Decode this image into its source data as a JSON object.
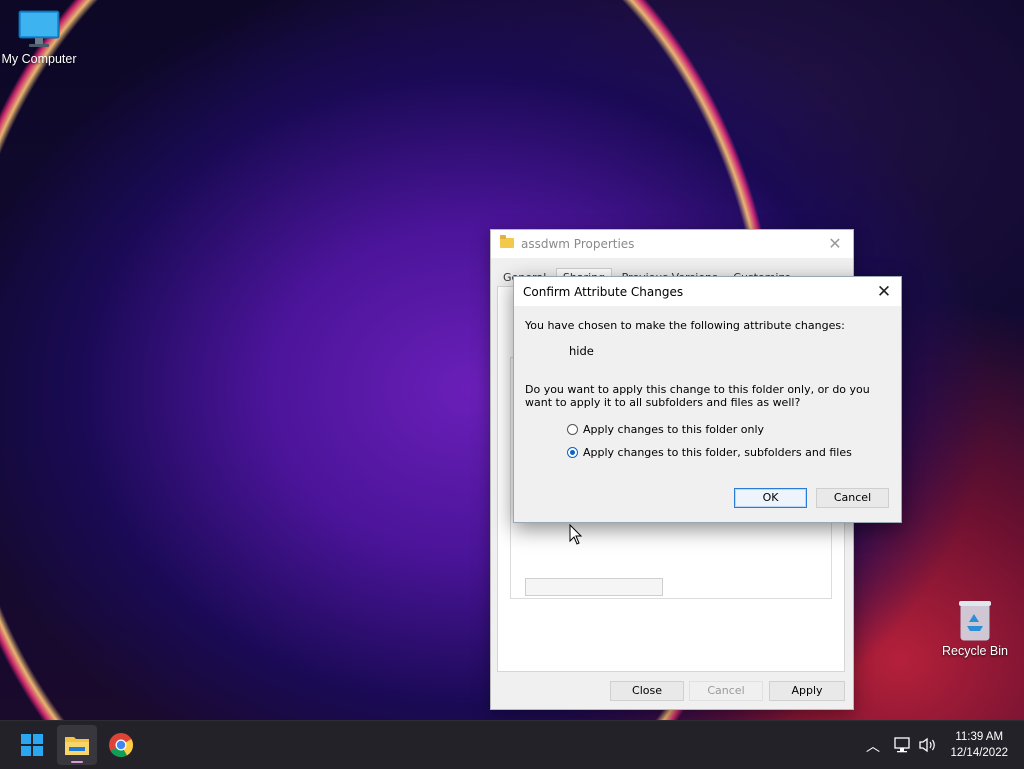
{
  "desktop": {
    "icons": [
      {
        "label": "My Computer",
        "icon": "monitor-icon"
      },
      {
        "label": "Recycle Bin",
        "icon": "recycle-bin-icon"
      }
    ]
  },
  "properties_window": {
    "title": "assdwm Properties",
    "tabs": [
      "General",
      "Sharing",
      "Previous Versions",
      "Customize"
    ],
    "active_tab": "Sharing",
    "buttons": {
      "close": "Close",
      "cancel": "Cancel",
      "apply": "Apply"
    }
  },
  "confirm_dialog": {
    "title": "Confirm Attribute Changes",
    "intro": "You have chosen to make the following attribute changes:",
    "attribute_change": "hide",
    "question": "Do you want to apply this change to this folder only, or do you want to apply it to all subfolders and files as well?",
    "options": [
      {
        "label": "Apply changes to this folder only",
        "checked": false
      },
      {
        "label": "Apply changes to this folder, subfolders and files",
        "checked": true
      }
    ],
    "ok_label": "OK",
    "cancel_label": "Cancel"
  },
  "taskbar": {
    "apps": [
      "start-icon",
      "file-explorer-icon",
      "chrome-icon"
    ],
    "active_app": "file-explorer-icon",
    "tray_icons": [
      "chevron-up-icon",
      "network-icon",
      "volume-icon"
    ],
    "time": "11:39 AM",
    "date": "12/14/2022"
  }
}
